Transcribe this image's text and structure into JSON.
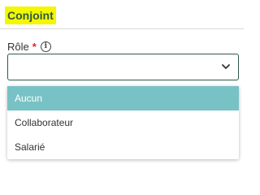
{
  "section": {
    "title": "Conjoint"
  },
  "field": {
    "label": "Rôle",
    "required_mark": "*",
    "info_icon": "info-icon",
    "value": "",
    "chevron_icon": "chevron-down-icon"
  },
  "dropdown": {
    "options": [
      {
        "label": "Aucun",
        "selected": true
      },
      {
        "label": "Collaborateur",
        "selected": false
      },
      {
        "label": "Salarié",
        "selected": false
      }
    ]
  },
  "colors": {
    "title_highlight": "#f3f700",
    "accent": "#2e5a4a",
    "required": "#e02424",
    "selected_bg": "#78c2c6",
    "divider": "#d8d8d8"
  }
}
